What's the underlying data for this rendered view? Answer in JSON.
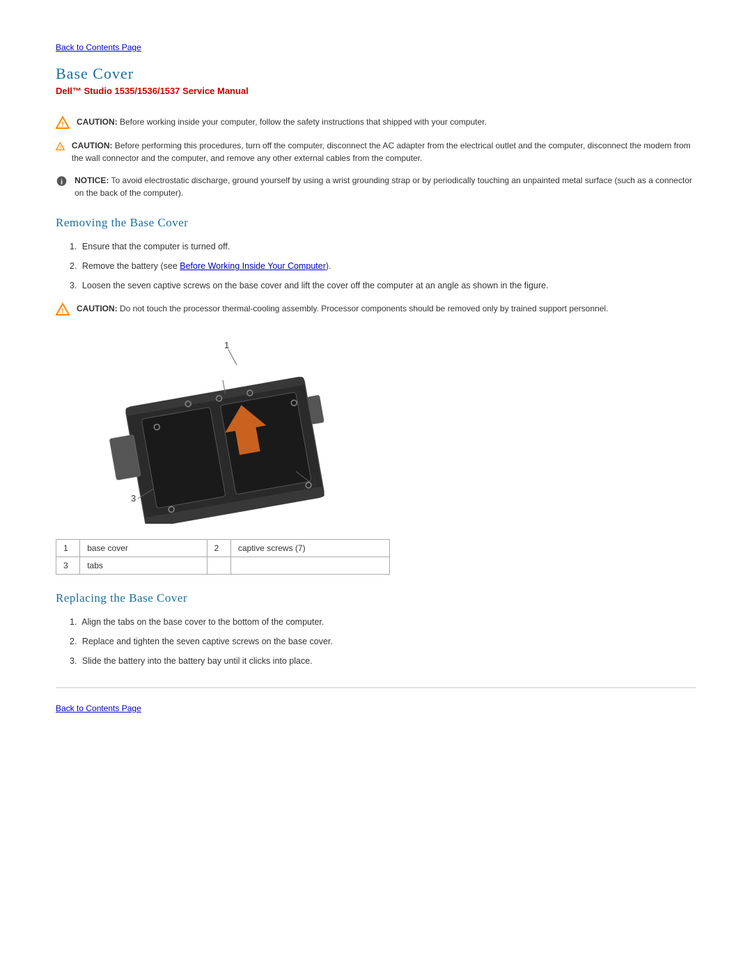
{
  "nav": {
    "back_link": "Back to Contents Page"
  },
  "header": {
    "title": "Base Cover",
    "subtitle": "Dell™ Studio 1535/1536/1537 Service Manual"
  },
  "cautions": [
    {
      "type": "caution",
      "label": "CAUTION:",
      "text": "Before working inside your computer, follow the safety instructions that shipped with your computer."
    },
    {
      "type": "caution",
      "label": "CAUTION:",
      "text": "Before performing this procedures, turn off the computer, disconnect the AC adapter from the electrical outlet and the computer, disconnect the modem from the wall connector and the computer, and remove any other external cables from the computer."
    },
    {
      "type": "notice",
      "label": "NOTICE:",
      "text": "To avoid electrostatic discharge, ground yourself by using a wrist grounding strap or by periodically touching an unpainted metal surface (such as a connector on the back of the computer)."
    }
  ],
  "removing": {
    "section_title": "Removing the Base Cover",
    "steps": [
      {
        "number": "1.",
        "text": "Ensure that the computer is turned off."
      },
      {
        "number": "2.",
        "text": "Remove the battery (see ",
        "link_text": "Before Working Inside Your Computer",
        "text_after": ")."
      },
      {
        "number": "3.",
        "text": "Loosen the seven captive screws on the base cover and lift the cover off the computer at an angle as shown in the figure."
      }
    ],
    "caution_after": {
      "label": "CAUTION:",
      "text": "Do not touch the processor thermal-cooling assembly. Processor components should be removed only by trained support personnel."
    }
  },
  "parts_table": {
    "rows": [
      {
        "col1_num": "1",
        "col1_label": "base cover",
        "col2_num": "2",
        "col2_label": "captive screws (7)"
      },
      {
        "col1_num": "3",
        "col1_label": "tabs",
        "col2_num": "",
        "col2_label": ""
      }
    ]
  },
  "replacing": {
    "section_title": "Replacing the Base Cover",
    "steps": [
      {
        "number": "1.",
        "text": "Align the tabs on the base cover to the bottom of the computer."
      },
      {
        "number": "2.",
        "text": "Replace and tighten the seven captive screws on the base cover."
      },
      {
        "number": "3.",
        "text": "Slide the battery into the battery bay until it clicks into place."
      }
    ]
  },
  "footer": {
    "back_link": "Back to Contents Page"
  }
}
